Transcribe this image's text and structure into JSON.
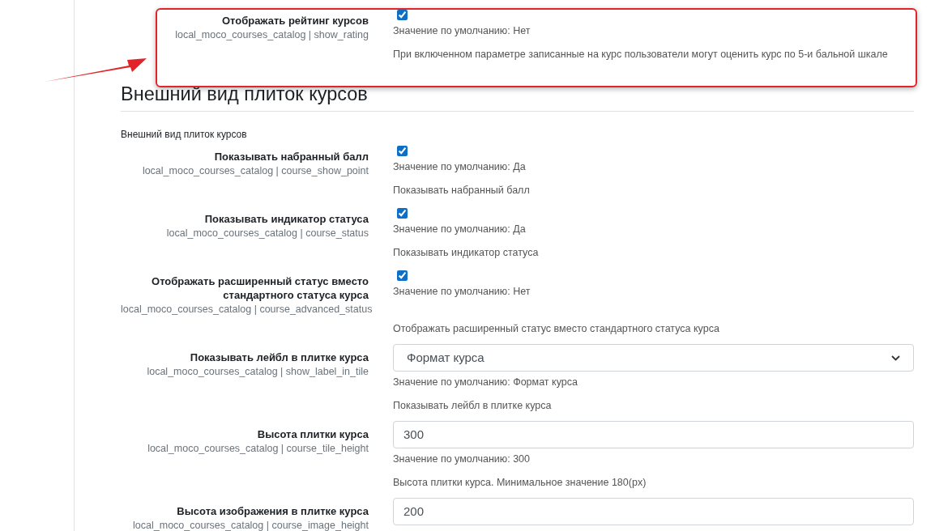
{
  "top_setting": {
    "kind": "checkbox",
    "title": "Отображать рейтинг курсов",
    "name": "local_moco_courses_catalog | show_rating",
    "checked": true,
    "default": "Значение по умолчанию: Нет",
    "description": "При включенном параметре записанные на курс пользователи могут оценить курс по 5-и бальной шкале",
    "highlighted": true
  },
  "section": {
    "heading": "Внешний вид плиток курсов",
    "description": "Внешний вид плиток курсов",
    "settings": [
      {
        "kind": "checkbox",
        "title": "Показывать набранный балл",
        "name": "local_moco_courses_catalog | course_show_point",
        "checked": true,
        "default": "Значение по умолчанию: Да",
        "description": "Показывать набранный балл"
      },
      {
        "kind": "checkbox",
        "title": "Показывать индикатор статуса",
        "name": "local_moco_courses_catalog | course_status",
        "checked": true,
        "default": "Значение по умолчанию: Да",
        "description": "Показывать индикатор статуса"
      },
      {
        "kind": "checkbox",
        "title": "Отображать расширенный статус вместо стандартного статуса курса",
        "name": "local_moco_courses_catalog | course_advanced_status",
        "checked": true,
        "default": "Значение по умолчанию: Нет",
        "description": "Отображать расширенный статус вместо стандартного статуса курса"
      },
      {
        "kind": "select",
        "title": "Показывать лейбл в плитке курса",
        "name": "local_moco_courses_catalog | show_label_in_tile",
        "value": "Формат курса",
        "default": "Значение по умолчанию: Формат курса",
        "description": "Показывать лейбл в плитке курса"
      },
      {
        "kind": "text",
        "title": "Высота плитки курса",
        "name": "local_moco_courses_catalog | course_tile_height",
        "value": "300",
        "default": "Значение по умолчанию: 300",
        "description": "Высота плитки курса. Минимальное значение 180(px)"
      },
      {
        "kind": "text",
        "title": "Высота изображения в плитке курса",
        "name": "local_moco_courses_catalog | course_image_height",
        "value": "200"
      }
    ]
  }
}
